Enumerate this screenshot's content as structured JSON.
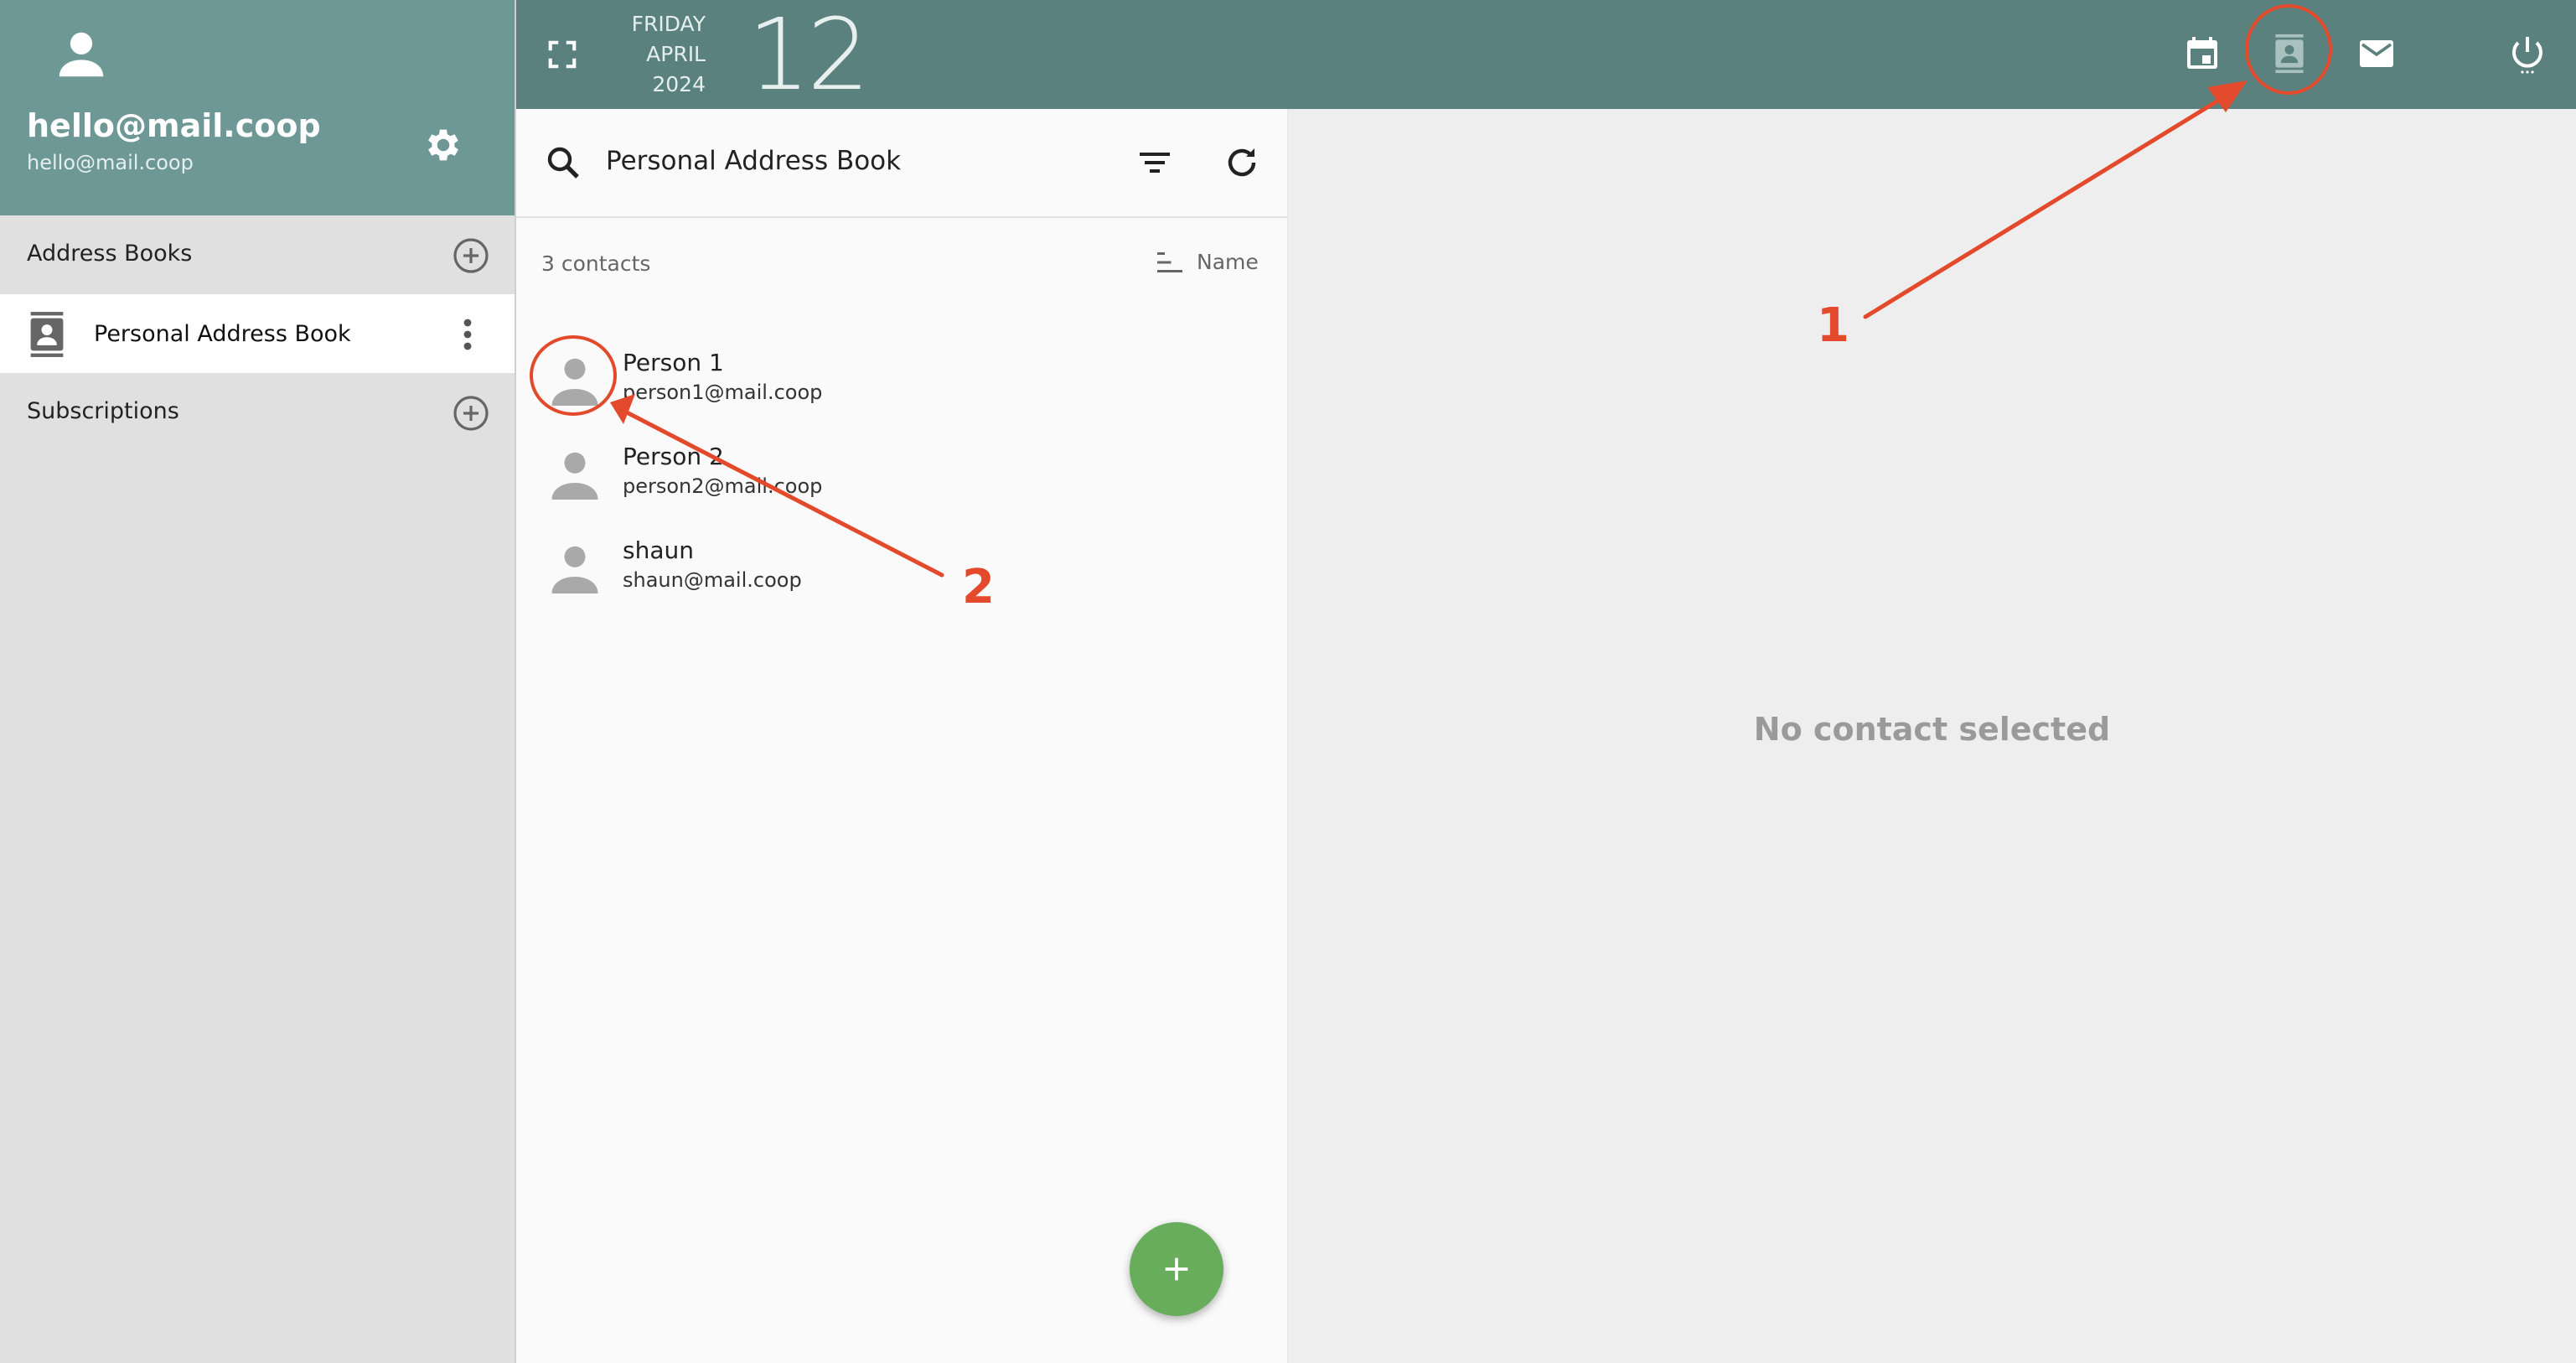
{
  "account": {
    "name": "hello@mail.coop",
    "email": "hello@mail.coop"
  },
  "sidebar": {
    "address_books_label": "Address Books",
    "address_book_items": [
      {
        "label": "Personal Address Book"
      }
    ],
    "subscriptions_label": "Subscriptions"
  },
  "topbar": {
    "date": {
      "weekday": "FRIDAY",
      "month": "APRIL",
      "year": "2024",
      "day": "12"
    },
    "icons": [
      "calendar-icon",
      "contacts-icon",
      "mail-icon",
      "power-icon"
    ]
  },
  "list": {
    "search_title": "Personal Address Book",
    "contact_count": "3 contacts",
    "sort_label": "Name",
    "contacts": [
      {
        "name": "Person 1",
        "email": "person1@mail.coop"
      },
      {
        "name": "Person 2",
        "email": "person2@mail.coop"
      },
      {
        "name": "shaun",
        "email": "shaun@mail.coop"
      }
    ]
  },
  "detail": {
    "empty_text": "No contact selected"
  },
  "annotations": {
    "markers": [
      "1",
      "2"
    ],
    "color": "#e34a2b"
  },
  "colors": {
    "header_bg": "#5b817f",
    "sidebar_header_bg": "#6d9896",
    "fab": "#67ad5b"
  }
}
